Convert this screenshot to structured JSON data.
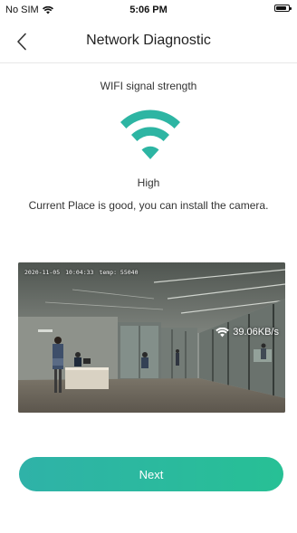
{
  "status_bar": {
    "carrier": "No SIM",
    "time": "5:06 PM"
  },
  "nav": {
    "title": "Network Diagnostic"
  },
  "signal": {
    "label": "WIFI signal strength",
    "strength": "High",
    "message": "Current Place is good, you can install the camera."
  },
  "preview": {
    "date": "2020-11-05",
    "clock": "10:04:33",
    "temp": "temp: 55040",
    "speed": "39.06KB/s"
  },
  "actions": {
    "next_label": "Next"
  },
  "colors": {
    "accent": "#2db5a3"
  }
}
